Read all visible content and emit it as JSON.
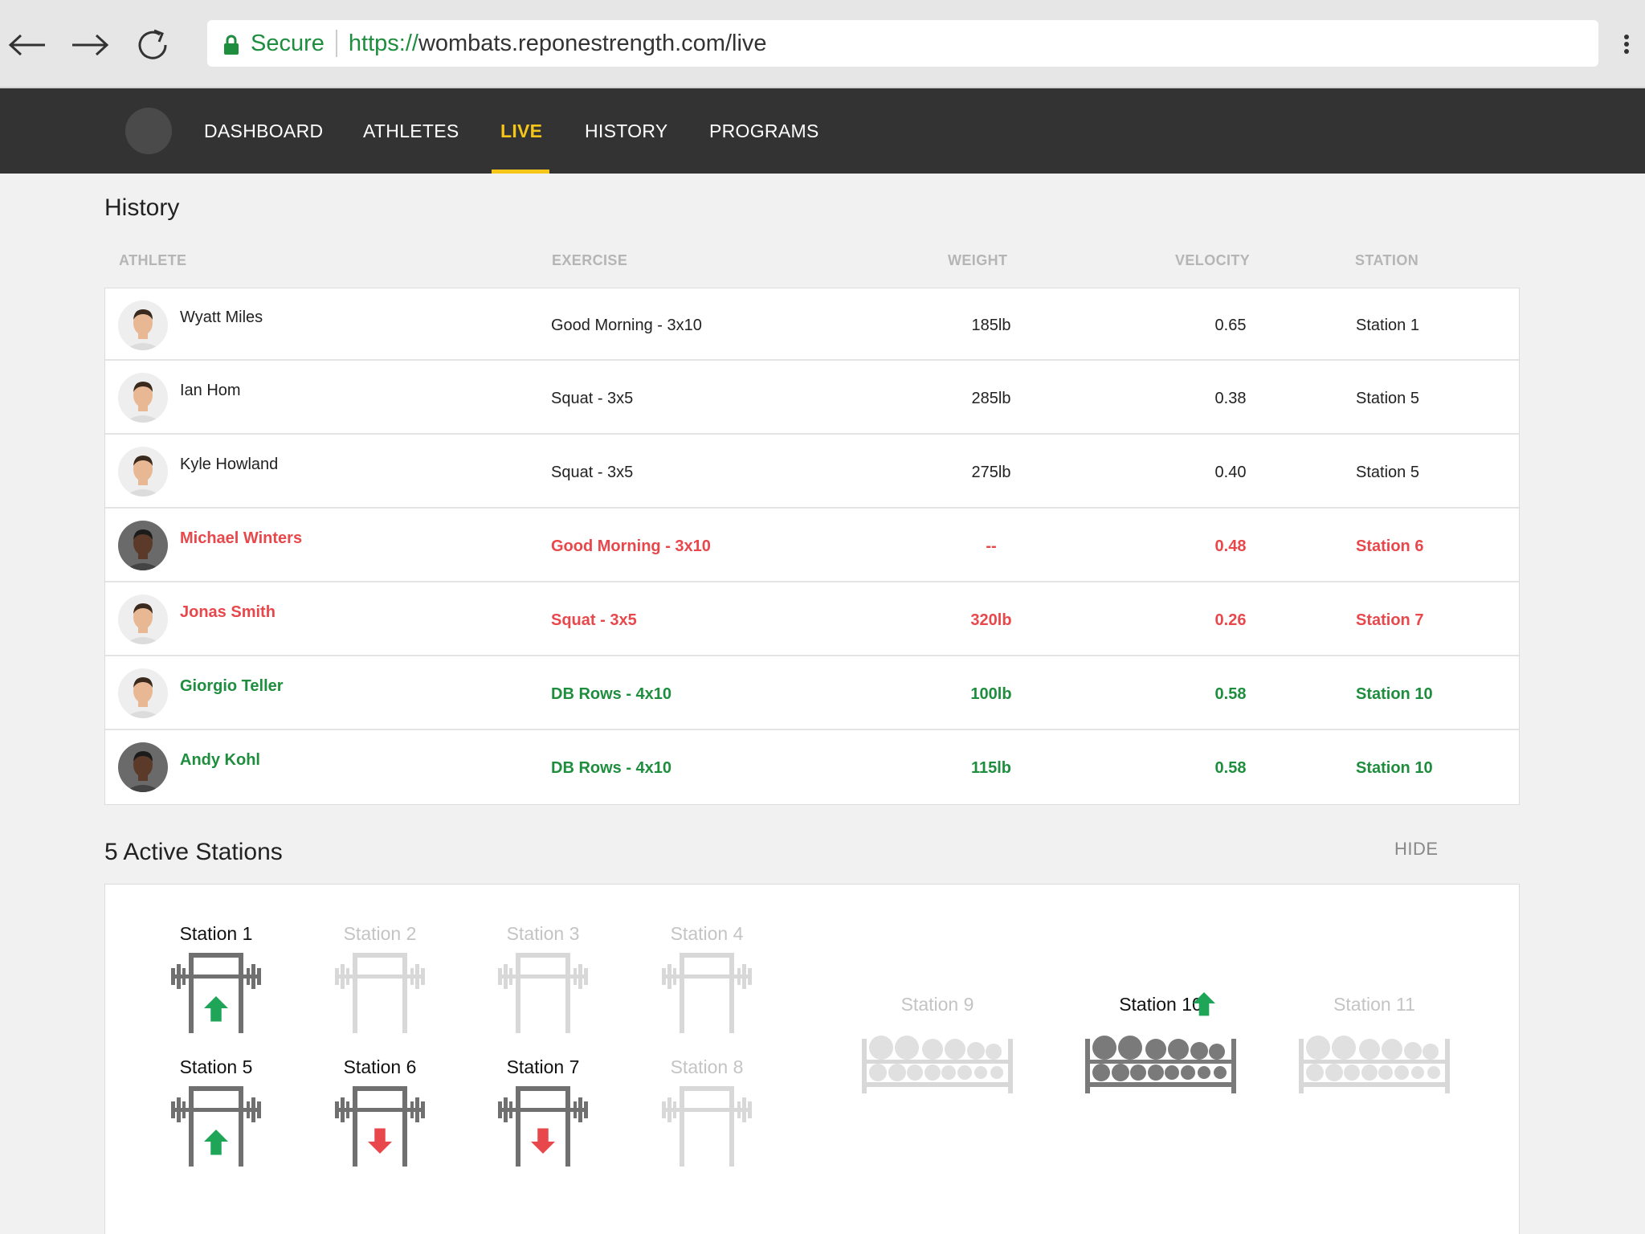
{
  "browser": {
    "secure_label": "Secure",
    "url_scheme": "https://",
    "url_rest": "wombats.reponestrength.com/live",
    "back_icon": "arrow-left-icon",
    "forward_icon": "arrow-right-icon",
    "reload_icon": "reload-icon",
    "menu_icon": "kebab-menu-icon"
  },
  "nav": {
    "items": [
      {
        "label": "DASHBOARD"
      },
      {
        "label": "ATHLETES"
      },
      {
        "label": "LIVE",
        "active": true
      },
      {
        "label": "HISTORY"
      },
      {
        "label": "PROGRAMS"
      }
    ],
    "accent_color": "#f5c518"
  },
  "history": {
    "title": "History",
    "columns": [
      "ATHLETE",
      "EXERCISE",
      "WEIGHT",
      "VELOCITY",
      "STATION"
    ],
    "status_colors": {
      "normal": "#222222",
      "alert": "#e8474b",
      "good": "#1e8e3e"
    },
    "rows": [
      {
        "athlete": "Wyatt Miles",
        "exercise": "Good Morning - 3x10",
        "weight": "185lb",
        "velocity": "0.65",
        "station": "Station 1",
        "status": "normal",
        "avatar": "light"
      },
      {
        "athlete": "Ian Hom",
        "exercise": "Squat - 3x5",
        "weight": "285lb",
        "velocity": "0.38",
        "station": "Station 5",
        "status": "normal",
        "avatar": "light"
      },
      {
        "athlete": "Kyle Howland",
        "exercise": "Squat - 3x5",
        "weight": "275lb",
        "velocity": "0.40",
        "station": "Station 5",
        "status": "normal",
        "avatar": "light"
      },
      {
        "athlete": "Michael Winters",
        "exercise": "Good Morning - 3x10",
        "weight": "--",
        "velocity": "0.48",
        "station": "Station 6",
        "status": "alert",
        "avatar": "dark"
      },
      {
        "athlete": "Jonas Smith",
        "exercise": "Squat - 3x5",
        "weight": "320lb",
        "velocity": "0.26",
        "station": "Station 7",
        "status": "alert",
        "avatar": "light"
      },
      {
        "athlete": "Giorgio Teller",
        "exercise": "DB Rows - 4x10",
        "weight": "100lb",
        "velocity": "0.58",
        "station": "Station 10",
        "status": "good",
        "avatar": "light"
      },
      {
        "athlete": "Andy Kohl",
        "exercise": "DB Rows - 4x10",
        "weight": "115lb",
        "velocity": "0.58",
        "station": "Station 10",
        "status": "good",
        "avatar": "dark"
      }
    ]
  },
  "stations": {
    "title": "5 Active Stations",
    "hide_label": "HIDE",
    "racks": [
      {
        "label": "Station 1",
        "active": true,
        "trend": "up"
      },
      {
        "label": "Station 2",
        "active": false,
        "trend": null
      },
      {
        "label": "Station 3",
        "active": false,
        "trend": null
      },
      {
        "label": "Station 4",
        "active": false,
        "trend": null
      },
      {
        "label": "Station 5",
        "active": true,
        "trend": "up"
      },
      {
        "label": "Station 6",
        "active": true,
        "trend": "down"
      },
      {
        "label": "Station 7",
        "active": true,
        "trend": "down"
      },
      {
        "label": "Station 8",
        "active": false,
        "trend": null
      }
    ],
    "dumbbell_racks": [
      {
        "label": "Station 9",
        "active": false,
        "trend": null
      },
      {
        "label": "Station 10",
        "active": true,
        "trend": "up"
      },
      {
        "label": "Station 11",
        "active": false,
        "trend": null
      }
    ]
  }
}
